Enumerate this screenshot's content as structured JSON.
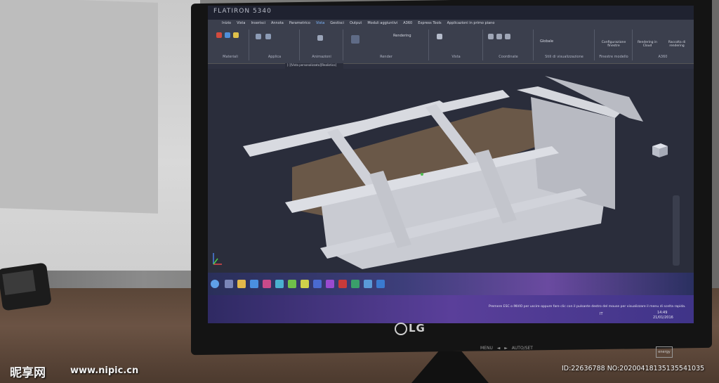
{
  "cad_app": {
    "brand": "FLATIRON 5340",
    "ribbon_tabs": [
      "Inizio",
      "Vista",
      "Inserisci",
      "Annota",
      "Parametrico",
      "Vista",
      "Gestisci",
      "Output",
      "Moduli aggiuntivi",
      "A360",
      "Express Tools",
      "Applicazioni in primo piano"
    ],
    "ribbon_groups": [
      {
        "label": "Materiali"
      },
      {
        "label": "Applica"
      },
      {
        "label": "Animazioni"
      },
      {
        "label": "Render"
      },
      {
        "label": "Vista"
      },
      {
        "label": "Coordinate"
      },
      {
        "label": "Stili di visualizzazione"
      },
      {
        "label": "Finestre modello"
      },
      {
        "label": "A360"
      }
    ],
    "ribbon_items": {
      "rendering_label": "Rendering",
      "globale": "Globale",
      "configurazione": "Configurazione finestre",
      "rendering_cloud": "Rendering in Cloud",
      "raccolta": "Raccolta di rendering"
    },
    "doc_tab": "[-][Vista personalizzata][Realistico]",
    "status_message": "Premere ESC o INVIO per uscire oppure fare clic con il pulsante destro del mouse per visualizzare il menu di scelta rapida.",
    "language": "IT",
    "time": "14:49",
    "date": "21/01/2016",
    "colors": {
      "viewport": "#2a2d3b",
      "model_face": "#c9cbd2",
      "model_wood": "#6a5848",
      "taskbar_accent": "#6a4aa0"
    }
  },
  "monitor": {
    "logo": "LG",
    "buttons": "MENU ◄ ► AUTO/SET",
    "energy": "energy"
  },
  "watermark": {
    "site_cn": "昵享网",
    "site_url": "www.nipic.cn",
    "id_line": "ID:22636788 NO:20200418135135541035"
  }
}
